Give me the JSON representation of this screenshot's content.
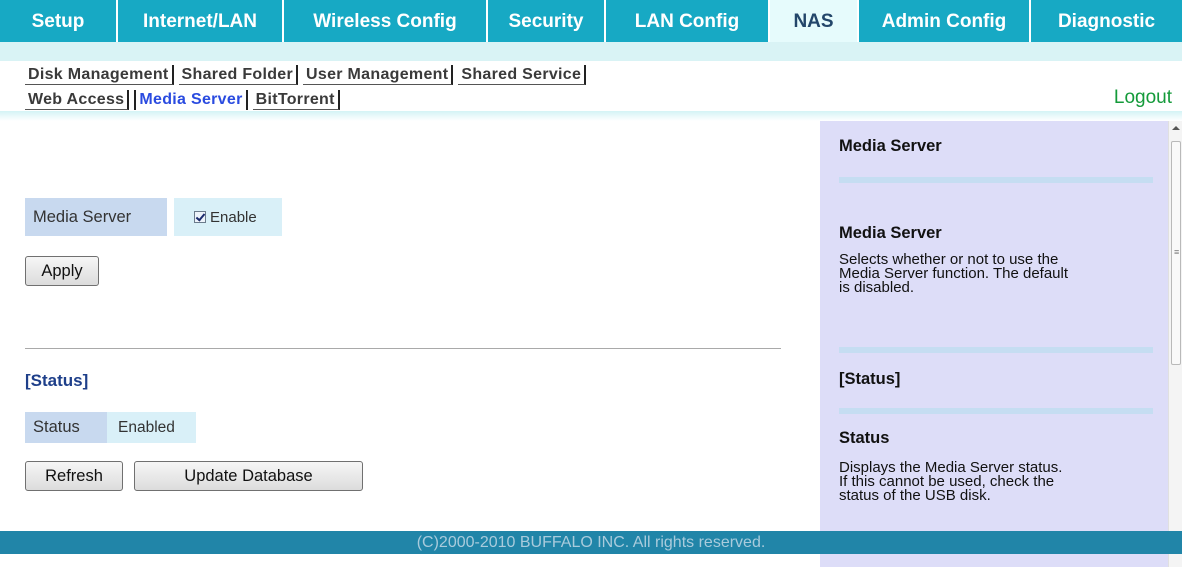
{
  "nav": {
    "tabs": [
      {
        "label": "Setup"
      },
      {
        "label": "Internet/LAN"
      },
      {
        "label": "Wireless Config"
      },
      {
        "label": "Security"
      },
      {
        "label": "LAN Config"
      },
      {
        "label": "NAS",
        "active": true
      },
      {
        "label": "Admin Config"
      },
      {
        "label": "Diagnostic"
      }
    ],
    "sub_row1": [
      "Disk Management",
      "Shared Folder",
      "User Management",
      "Shared Service"
    ],
    "sub_row2": [
      "Web Access",
      "Media Server",
      "BitTorrent"
    ],
    "active_sub": "Media Server",
    "logout": "Logout"
  },
  "main": {
    "media_server_label": "Media Server",
    "enable_label": "Enable",
    "enable_checked": true,
    "apply_button": "Apply",
    "status_heading": "[Status]",
    "status_label": "Status",
    "status_value": "Enabled",
    "refresh_button": "Refresh",
    "update_db_button": "Update Database"
  },
  "help": {
    "title": "Media Server",
    "section1_title": "Media Server",
    "section1_text": [
      "Selects whether or not to use the",
      "Media Server function. The default",
      "is disabled."
    ],
    "section2_heading": "[Status]",
    "section3_title": "Status",
    "section3_text": [
      "Displays the Media Server status.",
      "If this cannot be used, check the",
      "status of the USB disk."
    ]
  },
  "footer": {
    "copyright": "(C)2000-2010 BUFFALO INC. All rights reserved."
  },
  "colors": {
    "tab_bar": "#17a9c4",
    "active_tab_bg": "#e6fbfc",
    "sub_nav_bg": "#d9f3f5",
    "active_sub_link": "#2a4be0",
    "logout": "#149a3a",
    "label_cell": "#c8d9ef",
    "value_cell": "#d9f0f8",
    "help_panel": "#ddddf8",
    "footer": "#2185a8"
  }
}
